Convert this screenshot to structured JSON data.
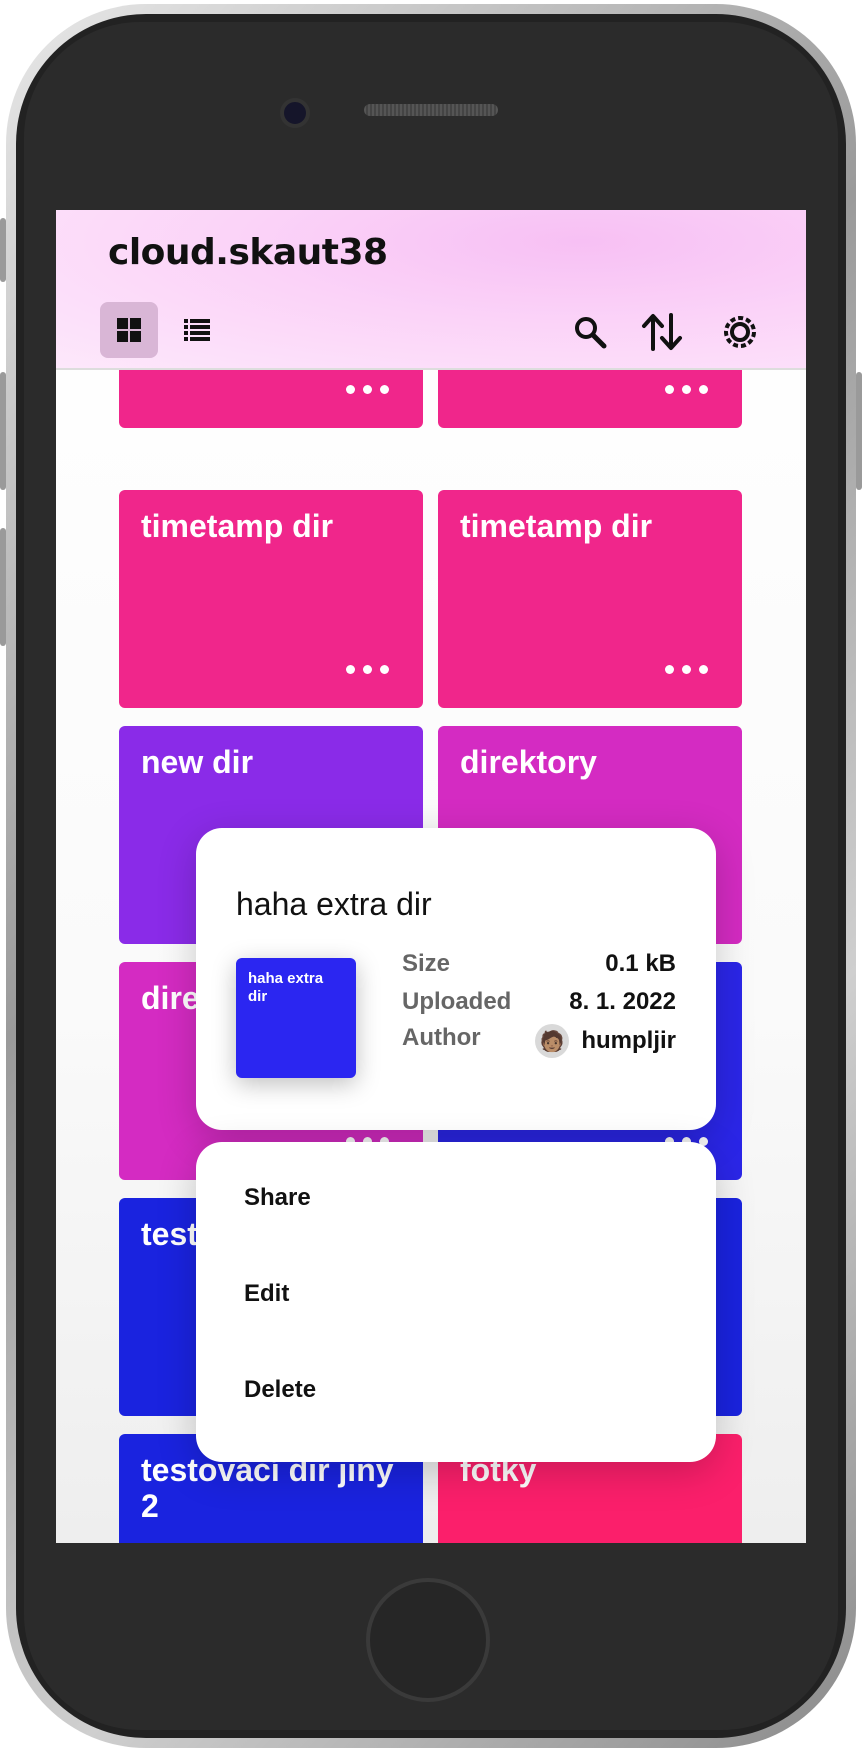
{
  "header": {
    "title": "cloud.skaut38",
    "grid_icon": "grid-view-icon",
    "list_icon": "list-view-icon",
    "search_icon": "search-icon",
    "sort_icon": "sort-icon",
    "settings_icon": "settings-icon",
    "accent": "#f9c2f5"
  },
  "grid": {
    "cards": [
      {
        "label": "",
        "color": "#f0268b"
      },
      {
        "label": "",
        "color": "#f0268b"
      },
      {
        "label": "timetamp dir",
        "color": "#f0268b"
      },
      {
        "label": "timetamp dir",
        "color": "#f0268b"
      },
      {
        "label": "new dir",
        "color": "#8a2be8"
      },
      {
        "label": "direktory",
        "color": "#d42bc2"
      },
      {
        "label": "dire",
        "color": "#d42bc2"
      },
      {
        "label": "",
        "color": "#2b26e8"
      },
      {
        "label": "test",
        "color": "#1a23df"
      },
      {
        "label": "",
        "color": "#1a23df"
      },
      {
        "label": "testovací dir jiný 2",
        "color": "#1a23df"
      },
      {
        "label": "fotky",
        "color": "#fb1f6b"
      }
    ]
  },
  "details": {
    "title": "haha extra dir",
    "thumb_label": "haha extra dir",
    "thumb_color": "#2b26f1",
    "size_label": "Size",
    "size_value": "0.1 kB",
    "uploaded_label": "Uploaded",
    "uploaded_value": "8. 1. 2022",
    "author_label": "Author",
    "author_value": "humpljir",
    "author_avatar": "🧑🏽"
  },
  "menu": {
    "share": "Share",
    "edit": "Edit",
    "delete": "Delete"
  }
}
